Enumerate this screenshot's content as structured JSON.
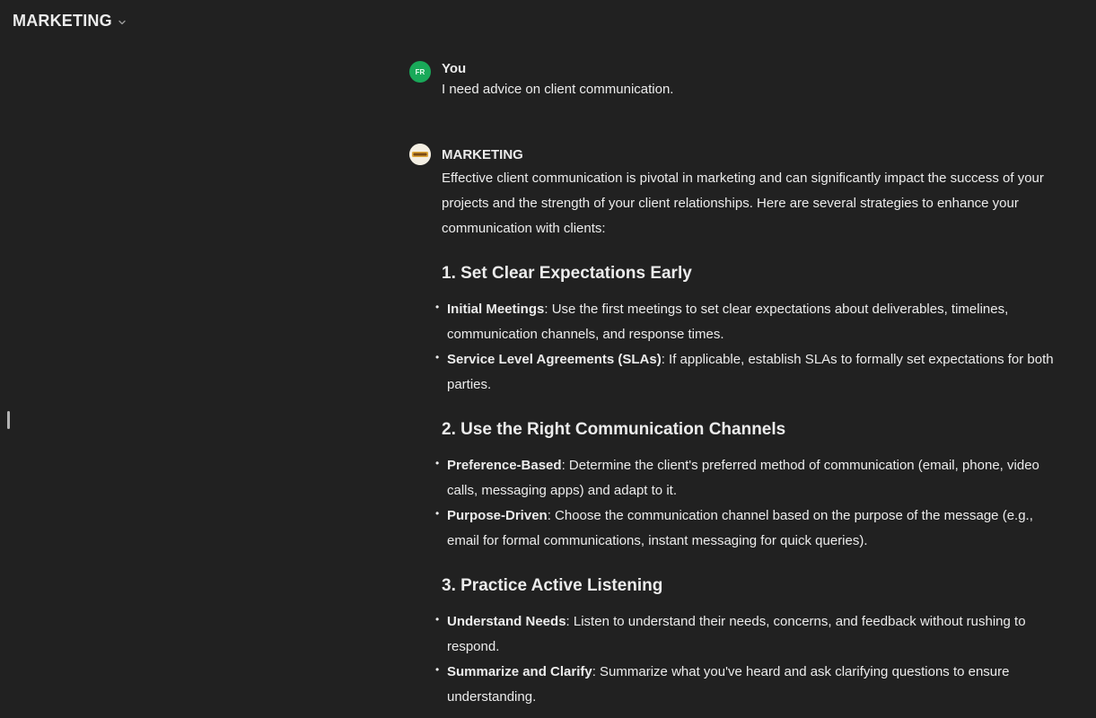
{
  "header": {
    "title": "MARKETING",
    "dropdown_icon": "chevron-down-icon"
  },
  "conversation": {
    "user_message": {
      "avatar_initials": "FR",
      "author": "You",
      "text": "I need advice on client communication."
    },
    "assistant_message": {
      "author": "MARKETING",
      "intro": "Effective client communication is pivotal in marketing and can significantly impact the success of your projects and the strength of your client relationships. Here are several strategies to enhance your communication with clients:",
      "sections": [
        {
          "heading": "1. Set Clear Expectations Early",
          "items": [
            {
              "label": "Initial Meetings",
              "text": ": Use the first meetings to set clear expectations about deliverables, timelines, communication channels, and response times."
            },
            {
              "label": "Service Level Agreements (SLAs)",
              "text": ": If applicable, establish SLAs to formally set expectations for both parties."
            }
          ]
        },
        {
          "heading": "2. Use the Right Communication Channels",
          "items": [
            {
              "label": "Preference-Based",
              "text": ": Determine the client's preferred method of communication (email, phone, video calls, messaging apps) and adapt to it."
            },
            {
              "label": "Purpose-Driven",
              "text": ": Choose the communication channel based on the purpose of the message (e.g., email for formal communications, instant messaging for quick queries)."
            }
          ]
        },
        {
          "heading": "3. Practice Active Listening",
          "items": [
            {
              "label": "Understand Needs",
              "text": ": Listen to understand their needs, concerns, and feedback without rushing to respond."
            },
            {
              "label": "Summarize and Clarify",
              "text": ": Summarize what you've heard and ask clarifying questions to ensure understanding."
            }
          ]
        }
      ]
    }
  },
  "colors": {
    "background": "#212121",
    "text": "#ececec",
    "user_avatar": "#19a959"
  }
}
